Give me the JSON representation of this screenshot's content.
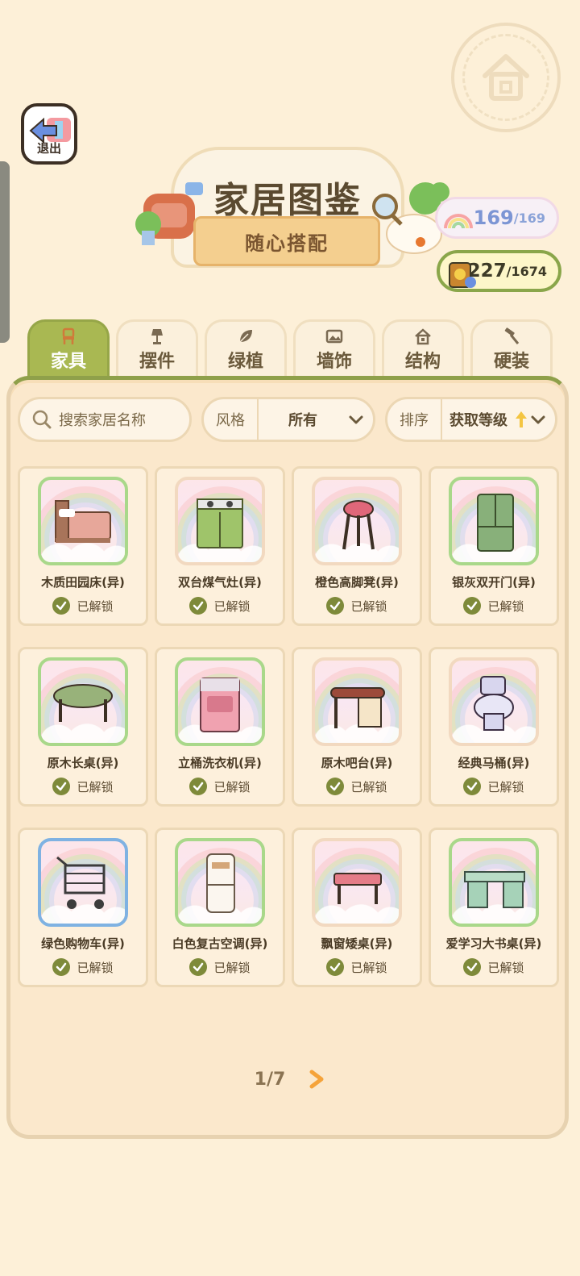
{
  "header": {
    "exit_label": "退出",
    "title": "家居图鉴",
    "subtitle": "随心搭配"
  },
  "stats": {
    "energy_current": "169",
    "energy_max": "/169",
    "coins_current": "1227",
    "coins_max": "/1674"
  },
  "tabs": [
    {
      "label": "家具",
      "icon": "chair-icon",
      "active": true
    },
    {
      "label": "摆件",
      "icon": "lamp-icon",
      "active": false
    },
    {
      "label": "绿植",
      "icon": "leaf-icon",
      "active": false
    },
    {
      "label": "墙饰",
      "icon": "picture-icon",
      "active": false
    },
    {
      "label": "结构",
      "icon": "house-icon",
      "active": false
    },
    {
      "label": "硬装",
      "icon": "hammer-icon",
      "active": false
    }
  ],
  "filters": {
    "search_placeholder": "搜索家居名称",
    "style_label": "风格",
    "style_value": "所有",
    "sort_label": "排序",
    "sort_value": "获取等级"
  },
  "items": [
    {
      "name": "木质田园床(异)",
      "status": "已解锁",
      "icon": "bed-icon",
      "frame": "green"
    },
    {
      "name": "双台煤气灶(异)",
      "status": "已解锁",
      "icon": "stove-icon",
      "frame": "pink"
    },
    {
      "name": "橙色高脚凳(异)",
      "status": "已解锁",
      "icon": "stool-icon",
      "frame": "pink"
    },
    {
      "name": "银灰双开门(异)",
      "status": "已解锁",
      "icon": "fridge-icon",
      "frame": "green"
    },
    {
      "name": "原木长桌(异)",
      "status": "已解锁",
      "icon": "table-icon",
      "frame": "green"
    },
    {
      "name": "立桶洗衣机(异)",
      "status": "已解锁",
      "icon": "washer-icon",
      "frame": "green"
    },
    {
      "name": "原木吧台(异)",
      "status": "已解锁",
      "icon": "bar-counter-icon",
      "frame": "pink"
    },
    {
      "name": "经典马桶(异)",
      "status": "已解锁",
      "icon": "toilet-icon",
      "frame": "pink"
    },
    {
      "name": "绿色购物车(异)",
      "status": "已解锁",
      "icon": "cart-icon",
      "frame": "blue"
    },
    {
      "name": "白色复古空调(异)",
      "status": "已解锁",
      "icon": "air-conditioner-icon",
      "frame": "green"
    },
    {
      "name": "飘窗矮桌(异)",
      "status": "已解锁",
      "icon": "low-table-icon",
      "frame": "pink"
    },
    {
      "name": "爱学习大书桌(异)",
      "status": "已解锁",
      "icon": "desk-icon",
      "frame": "green"
    }
  ],
  "pagination": {
    "label": "1/7",
    "current": 1,
    "total": 7
  },
  "colors": {
    "background": "#fdf0d8",
    "active_tab": "#a9b852",
    "unlock_check": "#7e8a3a",
    "page_arrow": "#f5a33a"
  }
}
